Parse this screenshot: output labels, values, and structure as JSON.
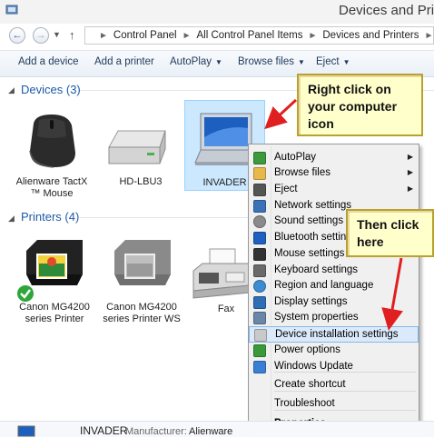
{
  "window": {
    "title": "Devices and Printe"
  },
  "nav": {
    "back_icon": "back-arrow-icon",
    "forward_icon": "forward-arrow-icon",
    "up_icon": "up-arrow-icon",
    "breadcrumb": [
      "Control Panel",
      "All Control Panel Items",
      "Devices and Printers"
    ]
  },
  "toolbar": {
    "add_device": "Add a device",
    "add_printer": "Add a printer",
    "autoplay": "AutoPlay",
    "browse_files": "Browse files",
    "eject": "Eject"
  },
  "devices": {
    "header": "Devices",
    "count": "(3)",
    "items": [
      {
        "label1": "Alienware TactX",
        "label2": "™ Mouse",
        "icon": "mouse-icon"
      },
      {
        "label1": "HD-LBU3",
        "label2": "",
        "icon": "external-drive-icon"
      },
      {
        "label1": "INVADER",
        "label2": "",
        "icon": "laptop-icon"
      }
    ]
  },
  "printers": {
    "header": "Printers",
    "count": "(4)",
    "items": [
      {
        "label1": "Canon MG4200",
        "label2": "series Printer",
        "icon": "printer-icon",
        "default": true
      },
      {
        "label1": "Canon MG4200",
        "label2": "series Printer WS",
        "icon": "printer-icon"
      },
      {
        "label1": "Fax",
        "label2": "",
        "icon": "fax-icon"
      }
    ]
  },
  "callouts": {
    "first": [
      "Right click on",
      "your computer",
      "icon"
    ],
    "second": [
      "Then click",
      "here"
    ]
  },
  "context_menu": {
    "items": [
      {
        "label": "AutoPlay",
        "submenu": true,
        "icon": "autoplay-icon"
      },
      {
        "label": "Browse files",
        "submenu": true,
        "icon": "folder-icon"
      },
      {
        "label": "Eject",
        "submenu": true,
        "icon": "eject-icon"
      },
      {
        "label": "Network settings",
        "icon": "network-icon"
      },
      {
        "label": "Sound settings",
        "icon": "sound-icon"
      },
      {
        "label": "Bluetooth settings",
        "icon": "bluetooth-icon"
      },
      {
        "label": "Mouse settings",
        "icon": "mouse-icon"
      },
      {
        "label": "Keyboard settings",
        "icon": "keyboard-icon"
      },
      {
        "label": "Region and language",
        "icon": "globe-icon"
      },
      {
        "label": "Display settings",
        "icon": "display-icon"
      },
      {
        "label": "System properties",
        "icon": "system-icon"
      },
      {
        "label": "Device installation settings",
        "icon": "device-install-icon",
        "highlighted": true
      },
      {
        "label": "Power options",
        "icon": "power-icon"
      },
      {
        "label": "Windows Update",
        "icon": "windows-update-icon"
      },
      {
        "label": "Create shortcut"
      },
      {
        "label": "Troubleshoot"
      },
      {
        "label": "Properties",
        "bold": true
      }
    ]
  },
  "details": {
    "name": "INVADER",
    "manufacturer_label": "Manufacturer:",
    "manufacturer_value": "Alienware"
  },
  "colors": {
    "accent_blue": "#1e5aa8",
    "callout_bg": "#ffffcc",
    "arrow_red": "#e02020",
    "highlight": "#dbeafb"
  }
}
